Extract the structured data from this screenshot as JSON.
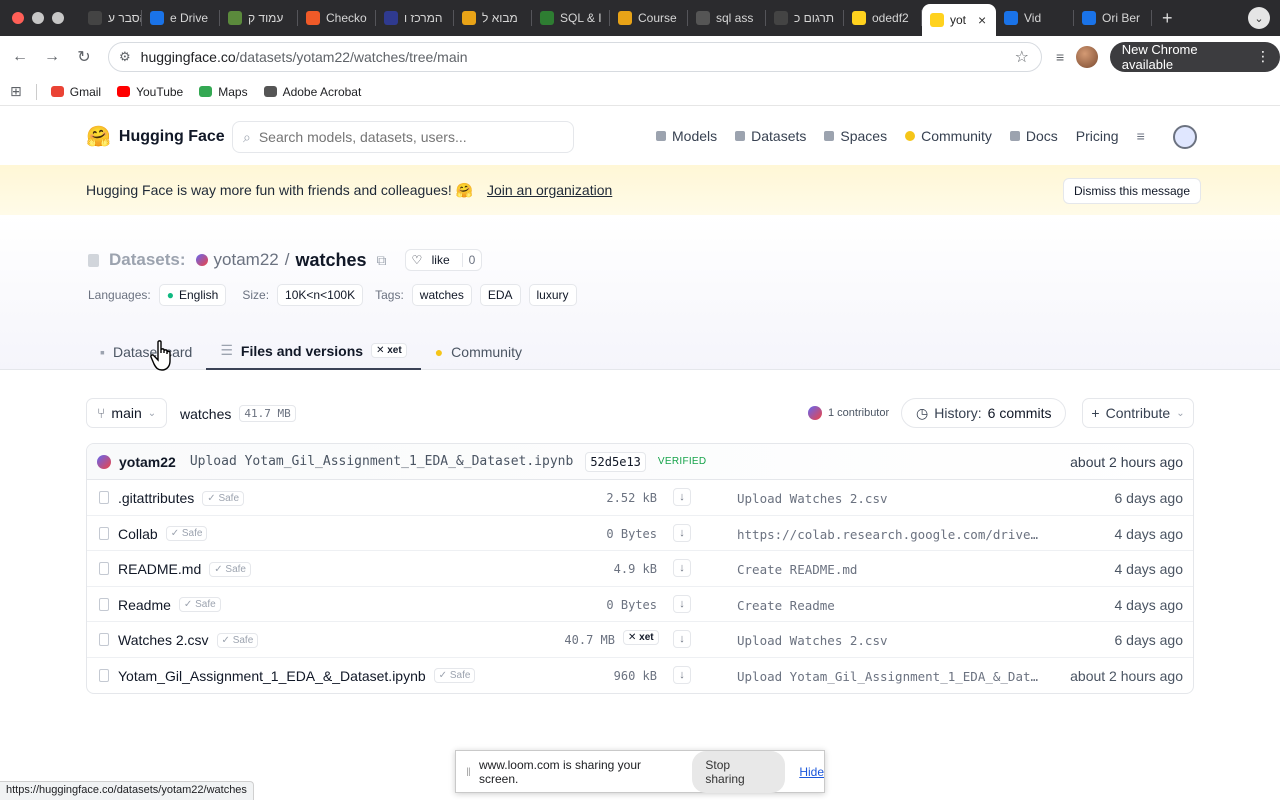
{
  "browser": {
    "tabs": [
      {
        "label": "הסבר ע",
        "color": "#444444"
      },
      {
        "label": "e Drive",
        "color": "#1a73e8"
      },
      {
        "label": "עמוד ק",
        "color": "#5b8a3c"
      },
      {
        "label": "Checko",
        "color": "#f05a28"
      },
      {
        "label": "המרכז ו",
        "color": "#2f3a8f"
      },
      {
        "label": "מבוא ל",
        "color": "#e8a317"
      },
      {
        "label": "SQL & I",
        "color": "#2e7d32"
      },
      {
        "label": "Course",
        "color": "#e8a317"
      },
      {
        "label": "sql ass",
        "color": "#555555"
      },
      {
        "label": "תרגום כ",
        "color": "#444444"
      },
      {
        "label": "odedf2",
        "color": "#ffd21e"
      },
      {
        "label": "yot",
        "color": "#ffd21e",
        "active": true
      },
      {
        "label": "Vid",
        "color": "#1a73e8"
      },
      {
        "label": "Ori Ber",
        "color": "#1a73e8"
      }
    ],
    "close_glyph": "×",
    "new_tab_glyph": "+",
    "url_host": "huggingface.co",
    "url_path": "/datasets/yotam22/watches/tree/main",
    "new_chrome": "New Chrome available",
    "bookmarks": [
      {
        "label": "Gmail",
        "color": "#ea4335"
      },
      {
        "label": "YouTube",
        "color": "#ff0000"
      },
      {
        "label": "Maps",
        "color": "#34a853"
      },
      {
        "label": "Adobe Acrobat",
        "color": "#555555"
      }
    ],
    "status_url": "https://huggingface.co/datasets/yotam22/watches"
  },
  "hf": {
    "brand": "Hugging Face",
    "search_placeholder": "Search models, datasets, users...",
    "nav": [
      "Models",
      "Datasets",
      "Spaces",
      "Community",
      "Docs",
      "Pricing"
    ]
  },
  "banner": {
    "text": "Hugging Face is way more fun with friends and colleagues! 🤗",
    "link": "Join an organization",
    "dismiss": "Dismiss this message"
  },
  "repo": {
    "type_label": "Datasets:",
    "owner": "yotam22",
    "separator": "/",
    "name": "watches",
    "like_label": "like",
    "like_count": "0",
    "languages_label": "Languages:",
    "language": "English",
    "size_label": "Size:",
    "size": "10K<n<100K",
    "tags_label": "Tags:",
    "tags": [
      "watches",
      "EDA",
      "luxury"
    ],
    "tabs": [
      "Dataset card",
      "Files and versions",
      "Community"
    ],
    "xet": "xet"
  },
  "files": {
    "branch": "main",
    "path": "watches",
    "total_size": "41.7 MB",
    "contributors": "1 contributor",
    "history_label": "History:",
    "history_count": "6 commits",
    "contribute": "Contribute",
    "last_commit": {
      "user": "yotam22",
      "message": "Upload Yotam_Gil_Assignment_1_EDA_&_Dataset.ipynb",
      "hash": "52d5e13",
      "verified": "VERIFIED",
      "when": "about 2 hours ago"
    },
    "safe_label": "Safe",
    "rows": [
      {
        "name": ".gitattributes",
        "size": "2.52 kB",
        "message": "Upload Watches 2.csv",
        "when": "6 days ago",
        "xet": false
      },
      {
        "name": "Collab",
        "size": "0 Bytes",
        "message": "https://colab.research.google.com/drive/…",
        "when": "4 days ago",
        "xet": false
      },
      {
        "name": "README.md",
        "size": "4.9 kB",
        "message": "Create README.md",
        "when": "4 days ago",
        "xet": false
      },
      {
        "name": "Readme",
        "size": "0 Bytes",
        "message": "Create Readme",
        "when": "4 days ago",
        "xet": false
      },
      {
        "name": "Watches 2.csv",
        "size": "40.7 MB",
        "message": "Upload Watches 2.csv",
        "when": "6 days ago",
        "xet": true
      },
      {
        "name": "Yotam_Gil_Assignment_1_EDA_&_Dataset.ipynb",
        "size": "960 kB",
        "message": "Upload Yotam_Gil_Assignment_1_EDA_&_Data…",
        "when": "about 2 hours ago",
        "xet": false
      }
    ]
  },
  "loom": {
    "text": "www.loom.com is sharing your screen.",
    "stop": "Stop sharing",
    "hide": "Hide"
  }
}
